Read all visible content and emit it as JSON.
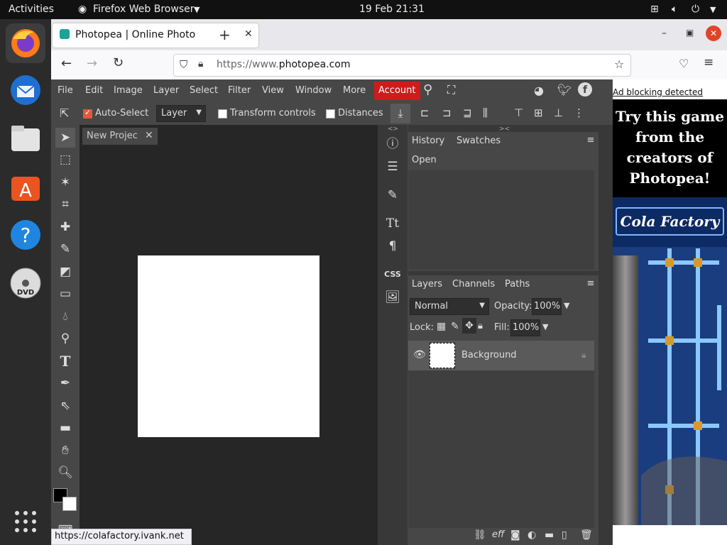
{
  "gnome": {
    "activities": "Activities",
    "app_name": "Firefox Web Browser",
    "clock": "19 Feb  21:31"
  },
  "firefox": {
    "tab_title": "Photopea | Online Photo",
    "url_prefix": "https://www.",
    "url_domain": "photopea.com",
    "status_url": "https://colafactory.ivank.net"
  },
  "photopea": {
    "menus": [
      "File",
      "Edit",
      "Image",
      "Layer",
      "Select",
      "Filter",
      "View",
      "Window",
      "More"
    ],
    "account": "Account",
    "options": {
      "auto_select": "Auto-Select",
      "layer_select": "Layer",
      "transform_controls": "Transform controls",
      "distances": "Distances"
    },
    "doc_tab": "New Projec",
    "history_panel": {
      "tabs": [
        "History",
        "Swatches"
      ],
      "items": [
        "Open"
      ]
    },
    "layers_panel": {
      "tabs": [
        "Layers",
        "Channels",
        "Paths"
      ],
      "blend_mode": "Normal",
      "opacity_label": "Opacity:",
      "opacity_value": "100%",
      "lock_label": "Lock:",
      "fill_label": "Fill:",
      "fill_value": "100%",
      "layers": [
        "Background"
      ]
    },
    "strip_css": "CSS"
  },
  "ad": {
    "notice": "Ad blocking detected",
    "headline": "Try this game from the creators of Photopea!",
    "brand": "Cola Factory"
  },
  "colors": {
    "accent": "#cc1c1c",
    "panel": "#474747",
    "dark": "#262626"
  }
}
